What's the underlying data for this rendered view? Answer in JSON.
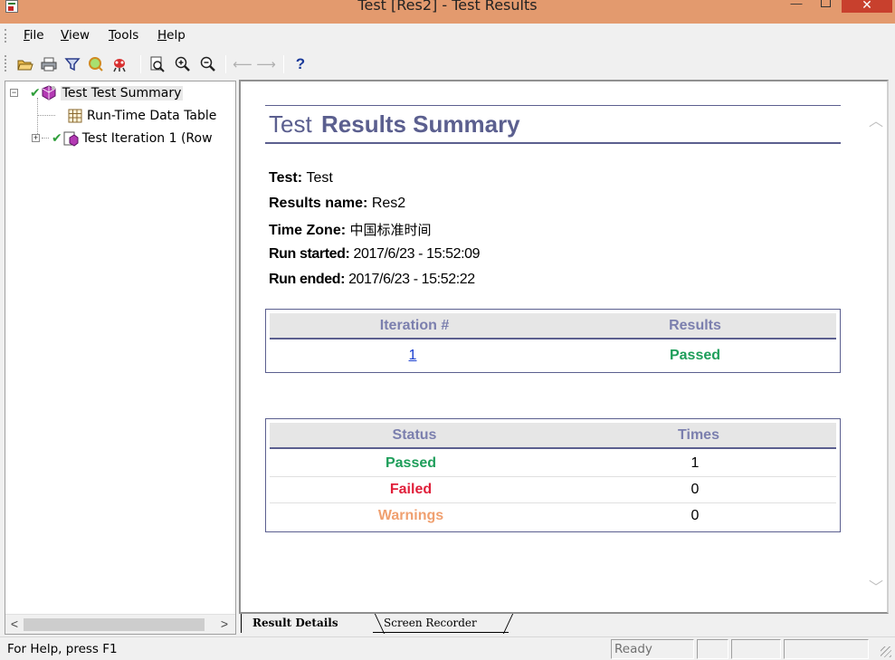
{
  "window": {
    "title": "Test [Res2] - Test Results",
    "controls": {
      "minimize": "—",
      "close": "✕"
    }
  },
  "menu": [
    "File",
    "View",
    "Tools",
    "Help"
  ],
  "toolbar": {
    "icons": [
      "open-folder-icon",
      "print-icon",
      "filter-icon",
      "find-icon",
      "bug-icon",
      "find-page-icon",
      "zoom-in-icon",
      "zoom-out-icon",
      "back-arrow-icon",
      "forward-arrow-icon",
      "help-icon"
    ],
    "help_glyph": "?"
  },
  "tree": {
    "items": [
      {
        "label": "Test Test Summary",
        "status": "passed",
        "expander": "−"
      },
      {
        "label": "Run-Time Data Table"
      },
      {
        "label": "Test Iteration 1 (Row",
        "status": "passed",
        "expander": "+"
      }
    ],
    "scroll_left": "<",
    "scroll_right": ">"
  },
  "report": {
    "heading_light": "Test",
    "heading_bold": "Results Summary",
    "fields": [
      {
        "label": "Test",
        "sep": ": ",
        "value": "Test"
      },
      {
        "label": "Results name",
        "sep": ": ",
        "value": "Res2"
      },
      {
        "label": "Time Zone",
        "sep": ": ",
        "value": "中国标准时间"
      },
      {
        "label": "Run started",
        "sep": ": ",
        "value": "2017/6/23 - 15:52:09"
      },
      {
        "label": "Run ended",
        "sep": ": ",
        "value": "2017/6/23 - 15:52:22"
      }
    ],
    "iterations_table": {
      "headers": [
        "Iteration #",
        "Results"
      ],
      "rows": [
        {
          "iteration": "1",
          "result": "Passed"
        }
      ]
    },
    "status_table": {
      "headers": [
        "Status",
        "Times"
      ],
      "rows": [
        {
          "status": "Passed",
          "times": "1"
        },
        {
          "status": "Failed",
          "times": "0"
        },
        {
          "status": "Warnings",
          "times": "0"
        }
      ]
    },
    "colors": {
      "accent": "#5b5f8f",
      "passed": "#1e9e5a",
      "failed": "#e0203b",
      "warnings": "#f0a070"
    }
  },
  "tabs": [
    "Result Details",
    "Screen Recorder"
  ],
  "status_bar": {
    "help": "For Help, press F1",
    "state": "Ready"
  }
}
